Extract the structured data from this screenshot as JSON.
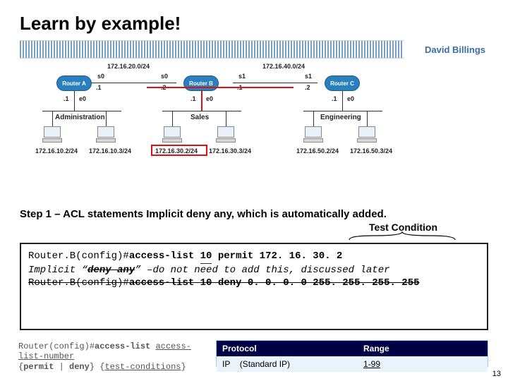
{
  "title": "Learn by example!",
  "author": "David Billings",
  "diagram": {
    "subnets": {
      "ab": "172.16.20.0/24",
      "bc": "172.16.40.0/24"
    },
    "routers": {
      "a": "Router A",
      "b": "Router B",
      "c": "Router C"
    },
    "depts": {
      "admin": "Administration",
      "sales": "Sales",
      "eng": "Engineering"
    },
    "ifs": {
      "s0": "s0",
      "s1": "s1",
      "e0": "e0",
      "dot1": ".1",
      "dot2": ".2"
    },
    "hosts": {
      "a1": "172.16.10.2/24",
      "a2": "172.16.10.3/24",
      "b1": "172.16.30.2/24",
      "b2": "172.16.30.3/24",
      "c1": "172.16.50.2/24",
      "c2": "172.16.50.3/24"
    }
  },
  "step": "Step 1 – ACL statements  Implicit deny any, which is automatically added.",
  "test_condition": "Test Condition",
  "code": {
    "l1_prefix": "Router.B(config)#",
    "l1_cmd": "access-list ",
    "l1_num": "10",
    "l1_rest": " permit 172. 16. 30. 2",
    "l2_italic": "Implicit “",
    "l2_strike": "deny any",
    "l2_rest": "” –do not need to add this, discussed later",
    "l3_prefix": "Router.B(config)#",
    "l3_cmd": "access-list 10 deny 0. 0. 0. 0 255. 255. 255. 255"
  },
  "syntax": {
    "line1a": "Router(config)#",
    "line1b": "access-list ",
    "line1c": "access-list-number",
    "line2a": "{",
    "line2b": "permit",
    "line2c": " | ",
    "line2d": "deny",
    "line2e": "} {",
    "line2f": "test-conditions",
    "line2g": "}"
  },
  "table": {
    "h1": "Protocol",
    "h2": "Range",
    "c1": "IP",
    "c1_paren": "(Standard IP)",
    "c2": "1-99"
  },
  "pagenum": "13"
}
